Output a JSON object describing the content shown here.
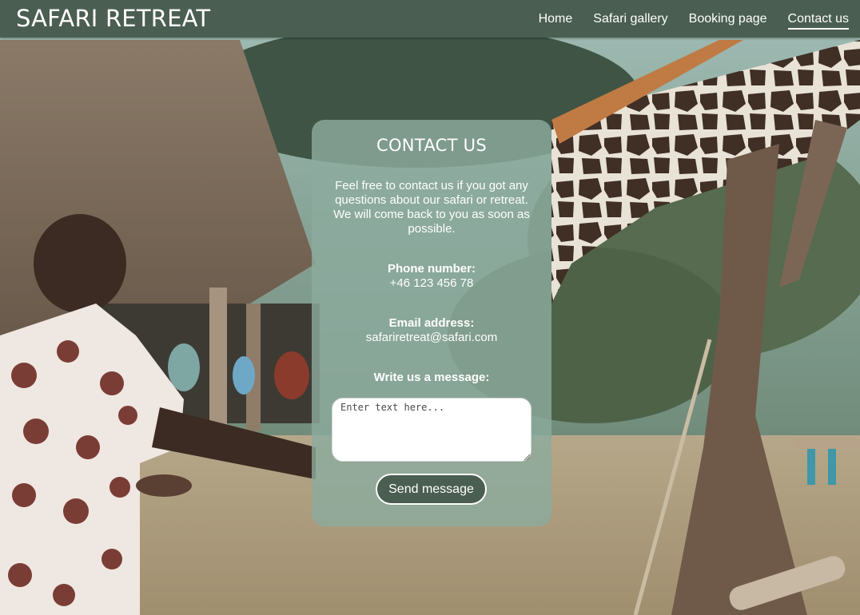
{
  "header": {
    "brand": "SAFARI RETREAT",
    "nav": [
      {
        "label": "Home",
        "active": false
      },
      {
        "label": "Safari gallery",
        "active": false
      },
      {
        "label": "Booking page",
        "active": false
      },
      {
        "label": "Contact us",
        "active": true
      }
    ]
  },
  "contact": {
    "title": "CONTACT US",
    "intro": "Feel free to contact us if you got any questions about our safari or retreat. We will come back to you as soon as possible.",
    "phone_label": "Phone number:",
    "phone_value": "+46 123 456 78",
    "email_label": "Email address:",
    "email_value": "safariretreat@safari.com",
    "message_label": "Write us a message:",
    "message_placeholder": "Enter text here...",
    "message_value": "",
    "send_label": "Send message"
  },
  "colors": {
    "header_bg": "#4a5e51",
    "card_bg": "#8cab9d",
    "button_bg": "#4a5e51",
    "text": "#ffffff"
  }
}
